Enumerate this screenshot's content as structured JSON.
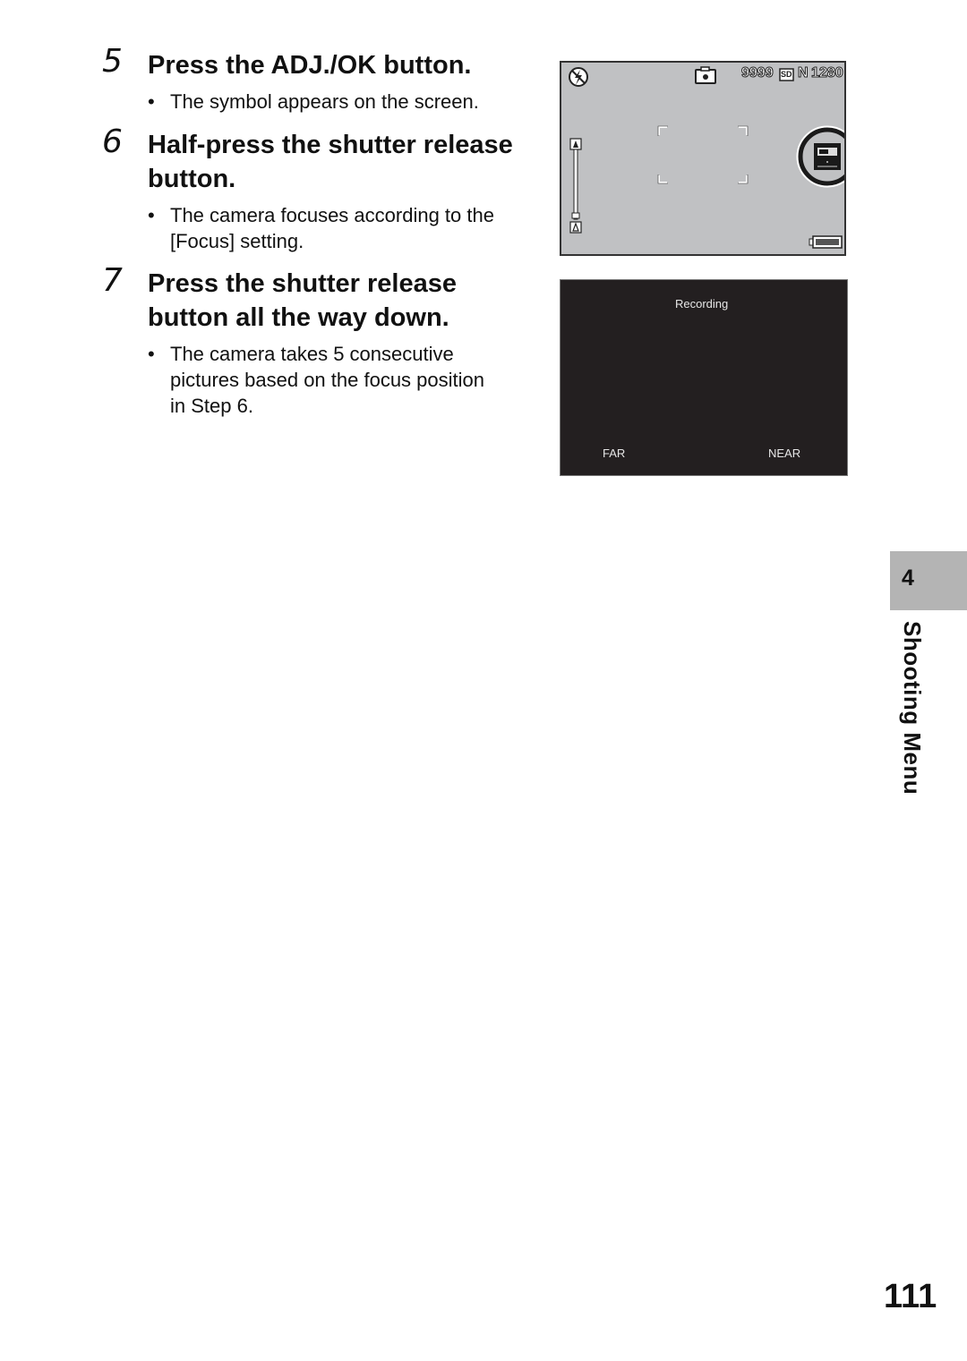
{
  "steps": [
    {
      "number": "5",
      "title_lines": [
        "Press the ADJ./OK button."
      ],
      "bullets": [
        [
          "The symbol appears on the screen."
        ]
      ]
    },
    {
      "number": "6",
      "title_lines": [
        "Half-press the shutter release",
        "button."
      ],
      "bullets": [
        [
          "The camera focuses according to the",
          "[Focus] setting."
        ]
      ]
    },
    {
      "number": "7",
      "title_lines": [
        "Press the shutter release",
        "button all the way down."
      ],
      "bullets": [
        [
          "The camera takes 5 consecutive",
          "pictures based on the focus position",
          "in Step 6."
        ]
      ]
    }
  ],
  "bullet_char": "•",
  "camera_screen": {
    "remaining_shots": "9999",
    "storage": "SD",
    "quality": "N",
    "image_size": "1280",
    "icons": [
      "flash-off-icon",
      "camera-mode-icon",
      "focus-bracket-icon",
      "battery-icon",
      "focus-scale-icon"
    ]
  },
  "recording_screen": {
    "status": "Recording",
    "left_label": "FAR",
    "right_label": "NEAR"
  },
  "side_tab": {
    "chapter": "4",
    "label": "Shooting Menu"
  },
  "page_number": "111"
}
